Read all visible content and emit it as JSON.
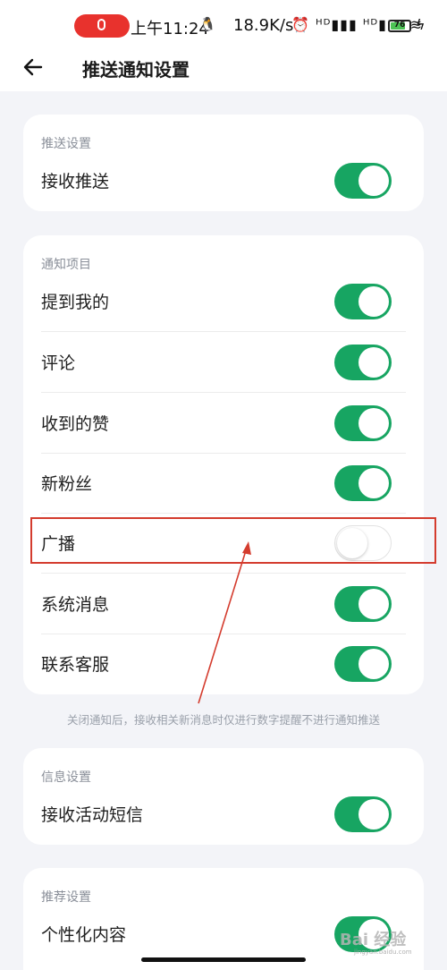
{
  "status_bar": {
    "time": "上午11:24",
    "net_speed": "18.9K/s",
    "icons": [
      "mic-icon",
      "qq-icon",
      "alarm-icon",
      "signal-hd-icon",
      "signal-hd-icon",
      "wifi-icon",
      "battery-icon",
      "charging-icon"
    ],
    "battery_level": "76",
    "signal_text": "⏰ ᴴᴰ▮▮▮ ᴴᴰ▮▮▮ ≋",
    "mic_color": "#e8322d",
    "battery_color": "#4cc254"
  },
  "header": {
    "back_icon": "back-arrow-icon",
    "title": "推送通知设置"
  },
  "sections": {
    "push": {
      "title": "推送设置",
      "items": [
        {
          "label": "接收推送",
          "on": true
        }
      ]
    },
    "notify": {
      "title": "通知项目",
      "items": [
        {
          "label": "提到我的",
          "on": true
        },
        {
          "label": "评论",
          "on": true
        },
        {
          "label": "收到的赞",
          "on": true
        },
        {
          "label": "新粉丝",
          "on": true
        },
        {
          "label": "广播",
          "on": false
        },
        {
          "label": "系统消息",
          "on": true
        },
        {
          "label": "联系客服",
          "on": true
        }
      ],
      "note": "关闭通知后，接收相关新消息时仅进行数字提醒不进行通知推送"
    },
    "info": {
      "title": "信息设置",
      "items": [
        {
          "label": "接收活动短信",
          "on": true
        }
      ]
    },
    "recommend": {
      "title": "推荐设置",
      "items": [
        {
          "label": "个性化内容",
          "on": true
        }
      ]
    }
  },
  "toggle_on_color": "#17a562",
  "annotation_color": "#d43c2e",
  "watermark": {
    "text": "Bai 经验",
    "sub": "jingyan.baidu.com"
  }
}
